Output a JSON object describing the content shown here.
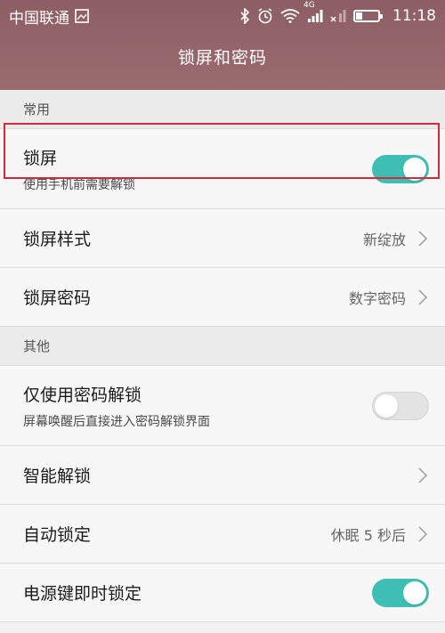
{
  "status_bar": {
    "carrier": "中国联通",
    "network_label": "4G",
    "time": "11:18",
    "icons": [
      "image-icon",
      "bluetooth-icon",
      "alarm-icon",
      "wifi-icon",
      "signal-icon",
      "no-signal-icon",
      "battery-icon"
    ]
  },
  "header": {
    "title": "锁屏和密码"
  },
  "sections": {
    "common": {
      "label": "常用"
    },
    "other": {
      "label": "其他"
    }
  },
  "rows": {
    "lock_screen": {
      "title": "锁屏",
      "subtitle": "使用手机前需要解锁",
      "toggle": "on"
    },
    "lock_style": {
      "title": "锁屏样式",
      "value": "新绽放"
    },
    "lock_password": {
      "title": "锁屏密码",
      "value": "数字密码"
    },
    "password_only": {
      "title": "仅使用密码解锁",
      "subtitle": "屏幕唤醒后直接进入密码解锁界面",
      "toggle": "off"
    },
    "smart_unlock": {
      "title": "智能解锁"
    },
    "auto_lock": {
      "title": "自动锁定",
      "value": "休眠 5 秒后"
    },
    "power_key_lock": {
      "title": "电源键即时锁定",
      "toggle": "on"
    }
  },
  "colors": {
    "header": "#8d5e63",
    "toggle_on": "#3fbfb3",
    "highlight": "#d7263d"
  }
}
